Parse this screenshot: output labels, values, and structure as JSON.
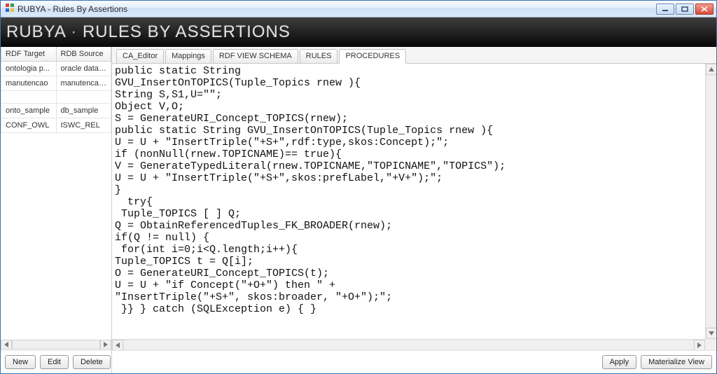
{
  "window": {
    "title": "RUBYA - Rules By Assertions"
  },
  "banner": {
    "left": "RUBYA",
    "sep": "·",
    "right": "RULES BY ASSERTIONS"
  },
  "left_panel": {
    "headers": {
      "rdf_target": "RDF Target",
      "rdb_source": "RDB Source"
    },
    "rows": [
      {
        "rdf": "ontologia p...",
        "rdb": "oracle datab..."
      },
      {
        "rdf": "manutencao",
        "rdb": "manutencao..."
      },
      {
        "rdf": "",
        "rdb": ""
      },
      {
        "rdf": "onto_sample",
        "rdb": "db_sample"
      },
      {
        "rdf": "CONF_OWL",
        "rdb": "ISWC_REL"
      }
    ],
    "buttons": {
      "new": "New",
      "edit": "Edit",
      "delete": "Delete"
    }
  },
  "tabs": [
    {
      "id": "ca_editor",
      "label": "CA_Editor",
      "active": false
    },
    {
      "id": "mappings",
      "label": "Mappings",
      "active": false
    },
    {
      "id": "rdf_view_schema",
      "label": "RDF VIEW SCHEMA",
      "active": false
    },
    {
      "id": "rules",
      "label": "RULES",
      "active": false
    },
    {
      "id": "procedures",
      "label": "PROCEDURES",
      "active": true
    }
  ],
  "code_lines": [
    "public static String",
    "GVU_InsertOnTOPICS(Tuple_Topics rnew ){",
    "String S,S1,U=\"\";",
    "Object V,O;",
    "S = GenerateURI_Concept_TOPICS(rnew);",
    "public static String GVU_InsertOnTOPICS(Tuple_Topics rnew ){",
    "U = U + \"InsertTriple(\"+S+\",rdf:type,skos:Concept);\";",
    "if (nonNull(rnew.TOPICNAME)== true){",
    "V = GenerateTypedLiteral(rnew.TOPICNAME,\"TOPICNAME\",\"TOPICS\");",
    "U = U + \"InsertTriple(\"+S+\",skos:prefLabel,\"+V+\");\";",
    "}",
    "  try{",
    " Tuple_TOPICS [ ] Q;",
    "Q = ObtainReferencedTuples_FK_BROADER(rnew);",
    "if(Q != null) {",
    " for(int i=0;i<Q.length;i++){",
    "Tuple_TOPICS t = Q[i];",
    "O = GenerateURI_Concept_TOPICS(t);",
    "U = U + \"if Concept(\"+O+\") then \" +",
    "\"InsertTriple(\"+S+\", skos:broader, \"+O+\");\";",
    " }} } catch (SQLException e) { }"
  ],
  "right_buttons": {
    "apply": "Apply",
    "materialize": "Materialize View"
  }
}
